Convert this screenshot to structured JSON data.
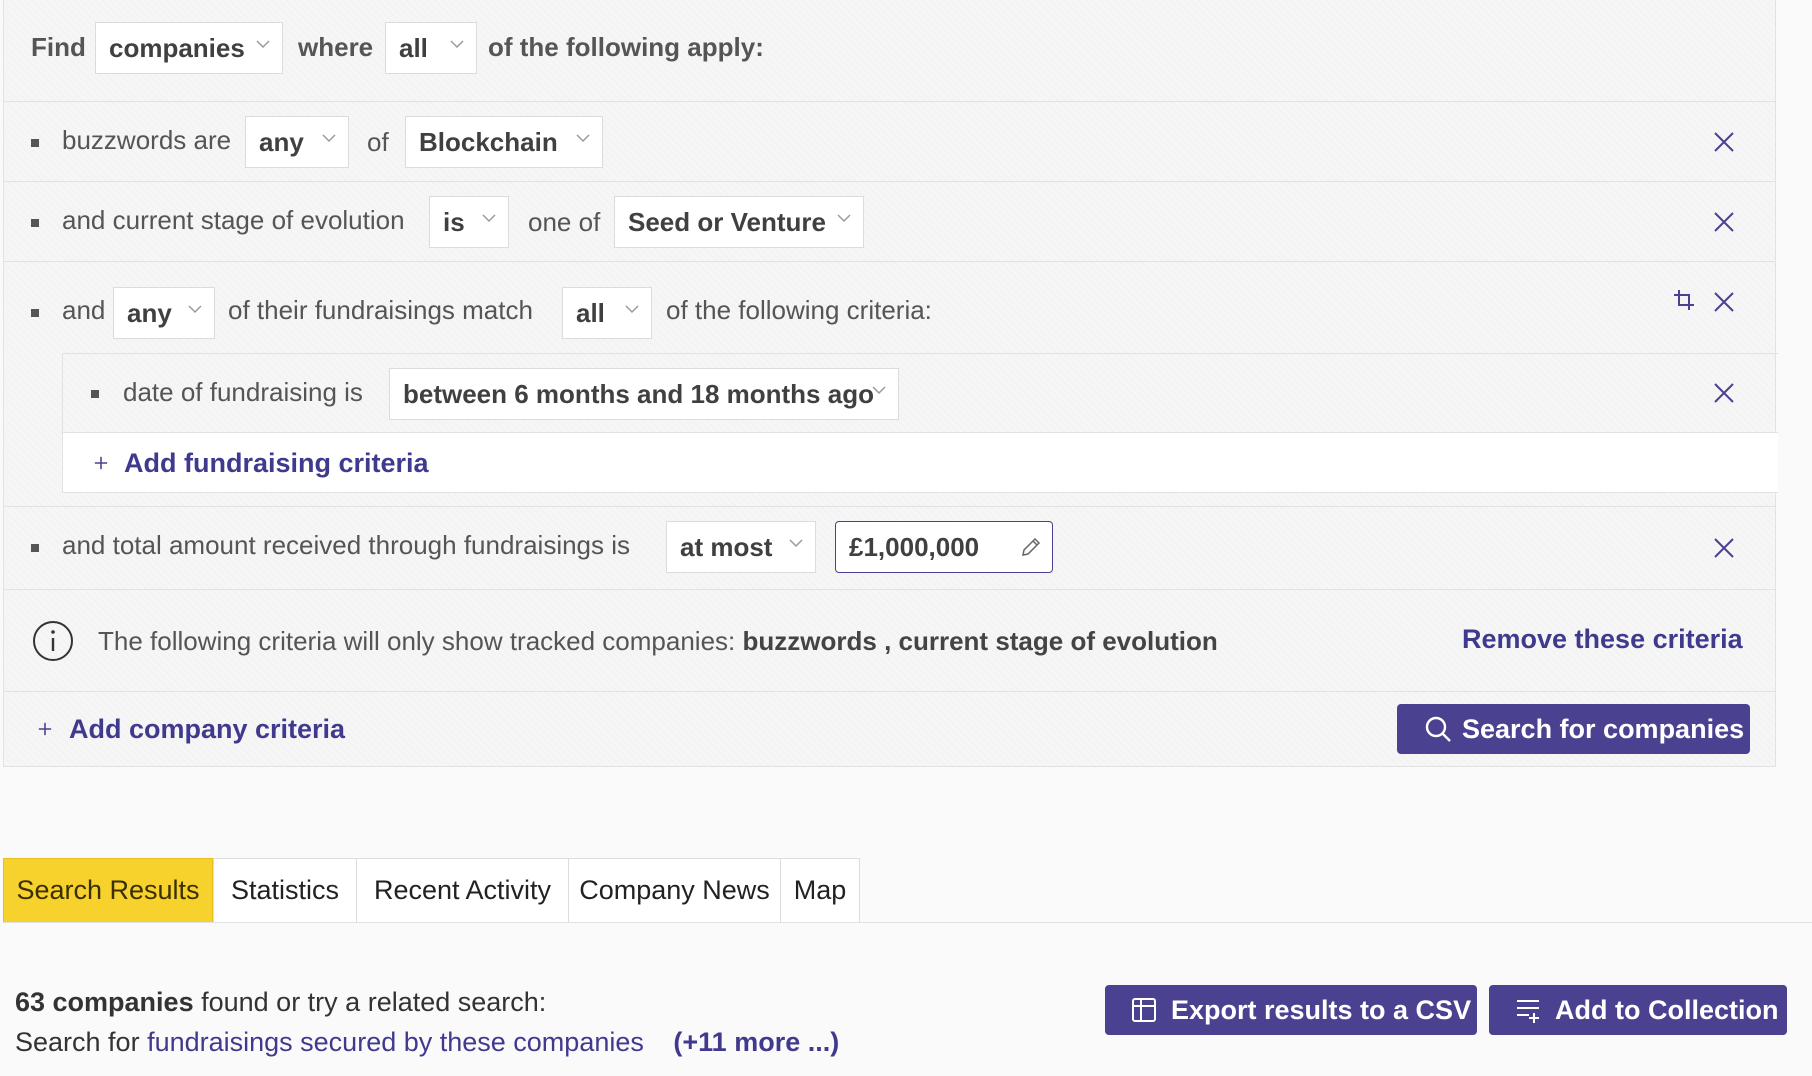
{
  "header": {
    "find": "Find",
    "entity": "companies",
    "where": "where",
    "quantifier": "all",
    "suffix": "of the following apply:"
  },
  "criteria": [
    {
      "prefix": "buzzwords are",
      "op": "any",
      "mid": "of",
      "value": "Blockchain"
    },
    {
      "prefix": "and current stage of evolution",
      "op": "is",
      "mid": "one of",
      "value": "Seed or Venture"
    },
    {
      "prefix": "and",
      "op": "any",
      "mid": "of their fundraisings match",
      "quantifier": "all",
      "suffix": "of the following criteria:",
      "sub": {
        "label": "date of fundraising is",
        "value": "between 6 months and 18 months ago"
      },
      "add_label": "Add fundraising criteria"
    },
    {
      "prefix": "and total amount received through fundraisings is",
      "op": "at most",
      "value": "£1,000,000"
    }
  ],
  "notice": {
    "text": "The following criteria will only show tracked companies:",
    "fields": "buzzwords , current stage of evolution",
    "remove_label": "Remove these criteria"
  },
  "footer": {
    "add_label": "Add company criteria",
    "search_label": "Search for companies"
  },
  "tabs": [
    "Search Results",
    "Statistics",
    "Recent Activity",
    "Company News",
    "Map"
  ],
  "results": {
    "count": "63 companies",
    "found_text": "found or try a related search:",
    "search_for": "Search for",
    "related_link": "fundraisings secured by these companies",
    "more_link": "(+11 more ...)",
    "export_label": "Export results to a CSV",
    "collection_label": "Add to Collection"
  },
  "colors": {
    "accent": "#4b4191",
    "link": "#403a8f",
    "active_tab": "#f8d22c"
  },
  "icons": [
    "chevron-down-icon",
    "close-icon",
    "crop-icon",
    "info-icon",
    "plus-icon",
    "pencil-icon",
    "search-icon",
    "table-icon",
    "list-add-icon"
  ]
}
